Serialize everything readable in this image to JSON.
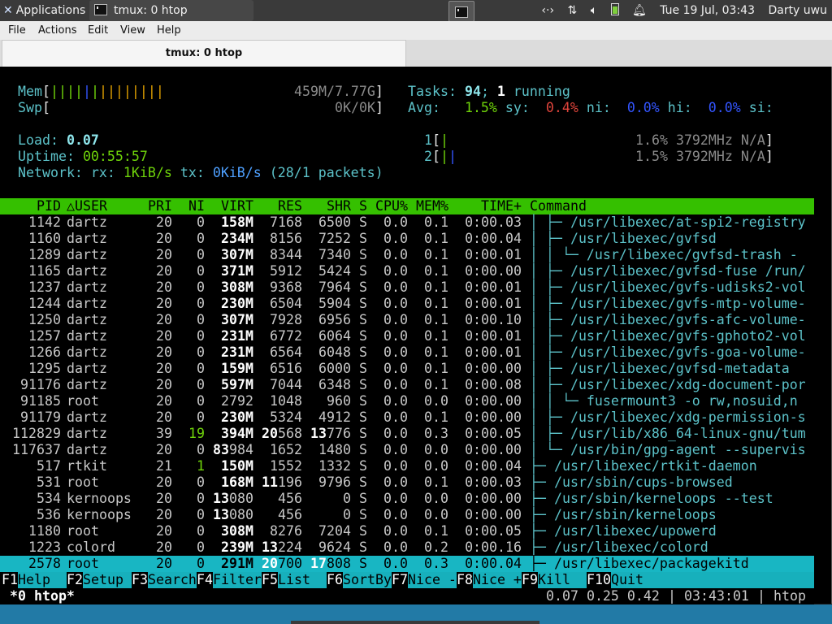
{
  "panel": {
    "apps_label": "Applications",
    "task_label": "tmux: 0 htop",
    "clock": "Tue 19 Jul, 03:43",
    "user": "Darty uwu",
    "tray_icons": [
      "network-arrows-icon",
      "transfer-icon",
      "volume-icon",
      "battery-icon",
      "bell-icon"
    ]
  },
  "menubar": {
    "file": "File",
    "actions": "Actions",
    "edit": "Edit",
    "view": "View",
    "help": "Help"
  },
  "tab": {
    "title": "tmux: 0 htop"
  },
  "meters": {
    "mem_label": "Mem",
    "mem_value": "459M/7.77G",
    "swp_label": "Swp",
    "swp_value": "0K/0K",
    "tasks_label": "Tasks:",
    "tasks_count": "94",
    "tasks_running": "1",
    "tasks_running_label": "running",
    "avg_label": "Avg:",
    "avg_value": "1.5%",
    "sy_label": "sy:",
    "sy_value": "0.4%",
    "ni_label": "ni:",
    "ni_value": "0.0%",
    "hi_label": "hi:",
    "hi_value": "0.0%",
    "si_label": "si:",
    "load_label": "Load:",
    "load_value": "0.07",
    "uptime_label": "Uptime:",
    "uptime_value": "00:55:57",
    "network_label": "Network: rx:",
    "rx_value": "1KiB/s",
    "tx_label": "tx:",
    "tx_value": "0KiB/s",
    "packets": "(28/1 packets)",
    "cpu1_label": "1",
    "cpu1_value": "1.6% 3792MHz N/A",
    "cpu2_label": "2",
    "cpu2_value": "1.5% 3792MHz N/A"
  },
  "columns": [
    "PID",
    "△USER",
    "PRI",
    "NI",
    "VIRT",
    "RES",
    "SHR",
    "S",
    "CPU%",
    "MEM%",
    "TIME+",
    "Command"
  ],
  "processes": [
    {
      "pid": "1142",
      "user": "dartz",
      "pri": "20",
      "ni": "0",
      "virt": "158M",
      "res": "7168",
      "shr": "6500",
      "s": "S",
      "cpu": "0.0",
      "mem": "0.1",
      "time": "0:00.03",
      "cmd": "│  ├─ /usr/libexec/at-spi2-registry"
    },
    {
      "pid": "1160",
      "user": "dartz",
      "pri": "20",
      "ni": "0",
      "virt": "234M",
      "res": "8156",
      "shr": "7252",
      "s": "S",
      "cpu": "0.0",
      "mem": "0.1",
      "time": "0:00.04",
      "cmd": "│  ├─ /usr/libexec/gvfsd"
    },
    {
      "pid": "1289",
      "user": "dartz",
      "pri": "20",
      "ni": "0",
      "virt": "307M",
      "res": "8344",
      "shr": "7340",
      "s": "S",
      "cpu": "0.0",
      "mem": "0.1",
      "time": "0:00.01",
      "cmd": "│  │  └─ /usr/libexec/gvfsd-trash -"
    },
    {
      "pid": "1165",
      "user": "dartz",
      "pri": "20",
      "ni": "0",
      "virt": "371M",
      "res": "5912",
      "shr": "5424",
      "s": "S",
      "cpu": "0.0",
      "mem": "0.1",
      "time": "0:00.00",
      "cmd": "│  ├─ /usr/libexec/gvfsd-fuse /run/"
    },
    {
      "pid": "1237",
      "user": "dartz",
      "pri": "20",
      "ni": "0",
      "virt": "308M",
      "res": "9368",
      "shr": "7964",
      "s": "S",
      "cpu": "0.0",
      "mem": "0.1",
      "time": "0:00.01",
      "cmd": "│  ├─ /usr/libexec/gvfs-udisks2-vol"
    },
    {
      "pid": "1244",
      "user": "dartz",
      "pri": "20",
      "ni": "0",
      "virt": "230M",
      "res": "6504",
      "shr": "5904",
      "s": "S",
      "cpu": "0.0",
      "mem": "0.1",
      "time": "0:00.01",
      "cmd": "│  ├─ /usr/libexec/gvfs-mtp-volume-"
    },
    {
      "pid": "1250",
      "user": "dartz",
      "pri": "20",
      "ni": "0",
      "virt": "307M",
      "res": "7928",
      "shr": "6956",
      "s": "S",
      "cpu": "0.0",
      "mem": "0.1",
      "time": "0:00.10",
      "cmd": "│  ├─ /usr/libexec/gvfs-afc-volume-"
    },
    {
      "pid": "1257",
      "user": "dartz",
      "pri": "20",
      "ni": "0",
      "virt": "231M",
      "res": "6772",
      "shr": "6064",
      "s": "S",
      "cpu": "0.0",
      "mem": "0.1",
      "time": "0:00.01",
      "cmd": "│  ├─ /usr/libexec/gvfs-gphoto2-vol"
    },
    {
      "pid": "1266",
      "user": "dartz",
      "pri": "20",
      "ni": "0",
      "virt": "231M",
      "res": "6564",
      "shr": "6048",
      "s": "S",
      "cpu": "0.0",
      "mem": "0.1",
      "time": "0:00.01",
      "cmd": "│  ├─ /usr/libexec/gvfs-goa-volume-"
    },
    {
      "pid": "1295",
      "user": "dartz",
      "pri": "20",
      "ni": "0",
      "virt": "159M",
      "res": "6516",
      "shr": "6000",
      "s": "S",
      "cpu": "0.0",
      "mem": "0.1",
      "time": "0:00.00",
      "cmd": "│  ├─ /usr/libexec/gvfsd-metadata"
    },
    {
      "pid": "91176",
      "user": "dartz",
      "pri": "20",
      "ni": "0",
      "virt": "597M",
      "res": "7044",
      "shr": "6348",
      "s": "S",
      "cpu": "0.0",
      "mem": "0.1",
      "time": "0:00.08",
      "cmd": "│  ├─ /usr/libexec/xdg-document-por"
    },
    {
      "pid": "91185",
      "user": "root",
      "pri": "20",
      "ni": "0",
      "virt": "2792",
      "res": "1048",
      "shr": "960",
      "s": "S",
      "cpu": "0.0",
      "mem": "0.0",
      "time": "0:00.00",
      "cmd": "│  │  └─ fusermount3 -o rw,nosuid,n"
    },
    {
      "pid": "91179",
      "user": "dartz",
      "pri": "20",
      "ni": "0",
      "virt": "230M",
      "res": "5324",
      "shr": "4912",
      "s": "S",
      "cpu": "0.0",
      "mem": "0.1",
      "time": "0:00.00",
      "cmd": "│  ├─ /usr/libexec/xdg-permission-s"
    },
    {
      "pid": "112829",
      "user": "dartz",
      "pri": "39",
      "ni": "19",
      "virt": "394M",
      "res": "20568",
      "shr": "13776",
      "s": "S",
      "cpu": "0.0",
      "mem": "0.3",
      "time": "0:00.05",
      "cmd": "│  ├─ /usr/lib/x86_64-linux-gnu/tum"
    },
    {
      "pid": "117637",
      "user": "dartz",
      "pri": "20",
      "ni": "0",
      "virt": "83984",
      "res": "1652",
      "shr": "1480",
      "s": "S",
      "cpu": "0.0",
      "mem": "0.0",
      "time": "0:00.00",
      "cmd": "│  └─ /usr/bin/gpg-agent --supervis"
    },
    {
      "pid": "517",
      "user": "rtkit",
      "pri": "21",
      "ni": "1",
      "virt": "150M",
      "res": "1552",
      "shr": "1332",
      "s": "S",
      "cpu": "0.0",
      "mem": "0.0",
      "time": "0:00.04",
      "cmd": "├─ /usr/libexec/rtkit-daemon"
    },
    {
      "pid": "531",
      "user": "root",
      "pri": "20",
      "ni": "0",
      "virt": "168M",
      "res": "11196",
      "shr": "9796",
      "s": "S",
      "cpu": "0.0",
      "mem": "0.1",
      "time": "0:00.03",
      "cmd": "├─ /usr/sbin/cups-browsed"
    },
    {
      "pid": "534",
      "user": "kernoops",
      "pri": "20",
      "ni": "0",
      "virt": "13080",
      "res": "456",
      "shr": "0",
      "s": "S",
      "cpu": "0.0",
      "mem": "0.0",
      "time": "0:00.00",
      "cmd": "├─ /usr/sbin/kerneloops --test"
    },
    {
      "pid": "536",
      "user": "kernoops",
      "pri": "20",
      "ni": "0",
      "virt": "13080",
      "res": "456",
      "shr": "0",
      "s": "S",
      "cpu": "0.0",
      "mem": "0.0",
      "time": "0:00.00",
      "cmd": "├─ /usr/sbin/kerneloops"
    },
    {
      "pid": "1180",
      "user": "root",
      "pri": "20",
      "ni": "0",
      "virt": "308M",
      "res": "8276",
      "shr": "7204",
      "s": "S",
      "cpu": "0.0",
      "mem": "0.1",
      "time": "0:00.05",
      "cmd": "├─ /usr/libexec/upowerd"
    },
    {
      "pid": "1223",
      "user": "colord",
      "pri": "20",
      "ni": "0",
      "virt": "239M",
      "res": "13224",
      "shr": "9624",
      "s": "S",
      "cpu": "0.0",
      "mem": "0.2",
      "time": "0:00.16",
      "cmd": "├─ /usr/libexec/colord"
    },
    {
      "pid": "2578",
      "user": "root",
      "pri": "20",
      "ni": "0",
      "virt": "291M",
      "res": "20700",
      "shr": "17808",
      "s": "S",
      "cpu": "0.0",
      "mem": "0.3",
      "time": "0:00.04",
      "cmd": "├─ /usr/libexec/packagekitd"
    }
  ],
  "selected_pid": "2578",
  "fkeys": [
    {
      "key": "F1",
      "label": "Help  "
    },
    {
      "key": "F2",
      "label": "Setup "
    },
    {
      "key": "F3",
      "label": "Search"
    },
    {
      "key": "F4",
      "label": "Filter"
    },
    {
      "key": "F5",
      "label": "List  "
    },
    {
      "key": "F6",
      "label": "SortBy"
    },
    {
      "key": "F7",
      "label": "Nice -"
    },
    {
      "key": "F8",
      "label": "Nice +"
    },
    {
      "key": "F9",
      "label": "Kill  "
    },
    {
      "key": "F10",
      "label": "Quit  "
    }
  ],
  "tmux": {
    "window": "*0 htop*",
    "loadavg": "0.07 0.25 0.42",
    "time": "03:43:01",
    "session_cmd": "htop"
  },
  "colors": {
    "header_bg": "#35c000",
    "selected_bg": "#18b6c3",
    "fkey_bg": "#17b0bc",
    "panel_bg": "#3a3a3a"
  }
}
